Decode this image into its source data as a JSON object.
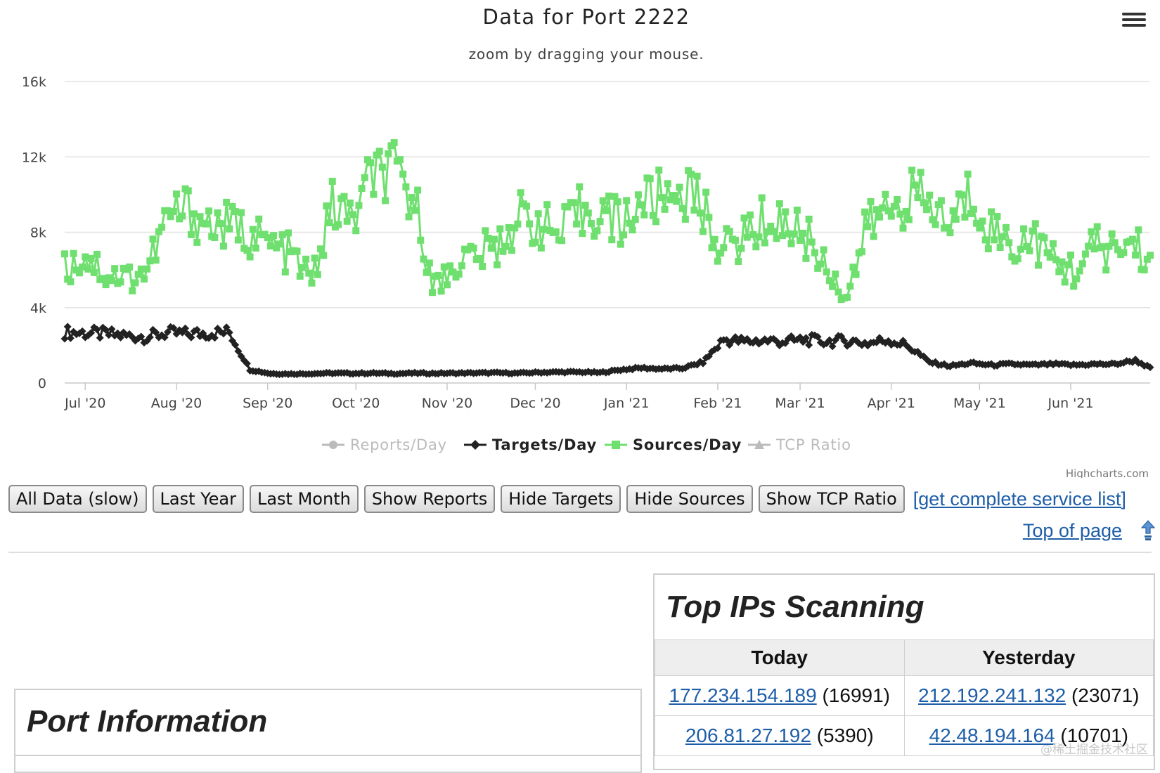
{
  "chart": {
    "title": "Data for Port 2222",
    "subtitle": "zoom by dragging your mouse.",
    "credits": "Highcharts.com",
    "y_ticks": [
      "0",
      "4k",
      "8k",
      "12k",
      "16k"
    ],
    "x_ticks": [
      "Jul '20",
      "Aug '20",
      "Sep '20",
      "Oct '20",
      "Nov '20",
      "Dec '20",
      "Jan '21",
      "Feb '21",
      "Mar '21",
      "Apr '21",
      "May '21",
      "Jun '21"
    ],
    "legend": [
      {
        "name": "Reports/Day",
        "color": "#bbbbbb",
        "marker": "circle",
        "active": false
      },
      {
        "name": "Targets/Day",
        "color": "#222222",
        "marker": "diamond",
        "active": true
      },
      {
        "name": "Sources/Day",
        "color": "#6fe06f",
        "marker": "square",
        "active": true
      },
      {
        "name": "TCP Ratio",
        "color": "#bbbbbb",
        "marker": "triangle",
        "active": false
      }
    ]
  },
  "chart_data": {
    "type": "line",
    "title": "Data for Port 2222",
    "subtitle": "zoom by dragging your mouse.",
    "xlabel": "",
    "ylabel": "",
    "ylim": [
      0,
      16000
    ],
    "x_range": [
      "2020-06-24",
      "2021-06-28"
    ],
    "grid": true,
    "legend_position": "bottom",
    "x": [
      "2020-06-24",
      "2020-07-01",
      "2020-07-08",
      "2020-07-15",
      "2020-07-22",
      "2020-07-29",
      "2020-08-05",
      "2020-08-12",
      "2020-08-19",
      "2020-08-26",
      "2020-09-02",
      "2020-09-09",
      "2020-09-16",
      "2020-09-23",
      "2020-09-30",
      "2020-10-07",
      "2020-10-14",
      "2020-10-21",
      "2020-10-28",
      "2020-11-04",
      "2020-11-11",
      "2020-11-18",
      "2020-11-25",
      "2020-12-02",
      "2020-12-09",
      "2020-12-16",
      "2020-12-23",
      "2020-12-30",
      "2021-01-06",
      "2021-01-13",
      "2021-01-20",
      "2021-01-27",
      "2021-02-03",
      "2021-02-10",
      "2021-02-17",
      "2021-02-24",
      "2021-03-03",
      "2021-03-10",
      "2021-03-17",
      "2021-03-24",
      "2021-03-31",
      "2021-04-07",
      "2021-04-14",
      "2021-04-21",
      "2021-04-28",
      "2021-05-05",
      "2021-05-12",
      "2021-05-19",
      "2021-05-26",
      "2021-06-02",
      "2021-06-09",
      "2021-06-16",
      "2021-06-23",
      "2021-06-28"
    ],
    "series": [
      {
        "name": "Targets/Day",
        "color": "#222222",
        "marker": "diamond",
        "values": [
          2700,
          2650,
          2600,
          2500,
          2450,
          2650,
          2600,
          2650,
          2700,
          700,
          500,
          480,
          500,
          520,
          510,
          520,
          500,
          520,
          510,
          520,
          530,
          540,
          520,
          560,
          580,
          580,
          550,
          700,
          800,
          750,
          780,
          1100,
          2300,
          2200,
          2250,
          2200,
          2300,
          2200,
          2250,
          2100,
          2300,
          1950,
          1100,
          900,
          1050,
          950,
          1000,
          950,
          1000,
          950,
          1000,
          1000,
          1200,
          800
        ]
      },
      {
        "name": "Sources/Day",
        "color": "#6fe06f",
        "marker": "square",
        "values": [
          6000,
          6800,
          5800,
          5600,
          6000,
          8800,
          9200,
          8400,
          8300,
          7900,
          7300,
          6800,
          5400,
          9400,
          8600,
          11100,
          11000,
          9600,
          5000,
          6400,
          6800,
          7200,
          8800,
          8600,
          7700,
          9000,
          9200,
          8400,
          9600,
          9800,
          10400,
          9200,
          7000,
          7800,
          8600,
          8500,
          7800,
          6200,
          4600,
          8400,
          9200,
          10000,
          9400,
          8400,
          10100,
          8200,
          7300,
          7800,
          6400,
          6000,
          7200,
          7000,
          7500,
          6400
        ]
      }
    ]
  },
  "toolbar": {
    "buttons": [
      "All Data (slow)",
      "Last Year",
      "Last Month",
      "Show Reports",
      "Hide Targets",
      "Hide Sources",
      "Show TCP Ratio"
    ],
    "service_link": "[get complete service list]",
    "top_link": "Top of page"
  },
  "port_info": {
    "title": "Port Information"
  },
  "top_ips": {
    "title": "Top IPs Scanning",
    "headers": [
      "Today",
      "Yesterday"
    ],
    "rows": [
      {
        "today_ip": "177.234.154.189",
        "today_count": "(16991)",
        "yesterday_ip": "212.192.241.132",
        "yesterday_count": "(23071)"
      },
      {
        "today_ip": "206.81.27.192",
        "today_count": "(5390)",
        "yesterday_ip": "42.48.194.164",
        "yesterday_count": "(10701)"
      }
    ]
  },
  "watermark": "@稀土掘金技术社区"
}
